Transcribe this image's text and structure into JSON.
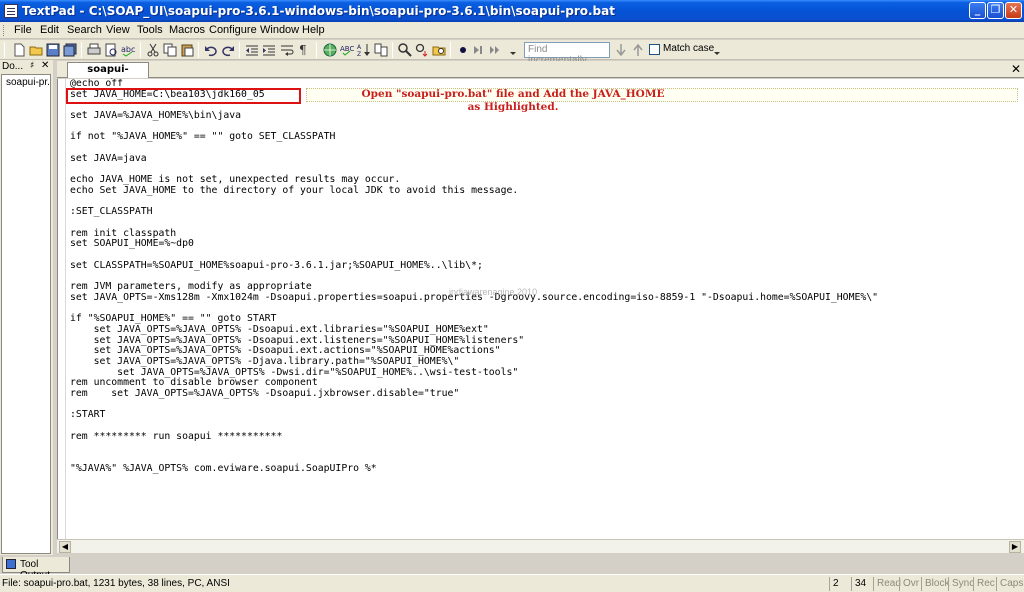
{
  "window": {
    "title": "TextPad - C:\\SOAP_UI\\soapui-pro-3.6.1-windows-bin\\soapui-pro-3.6.1\\bin\\soapui-pro.bat",
    "minimize": "_",
    "maximize": "❐",
    "close": "✕"
  },
  "menu": [
    "File",
    "Edit",
    "Search",
    "View",
    "Tools",
    "Macros",
    "Configure",
    "Window",
    "Help"
  ],
  "toolbar": {
    "find_placeholder": "Find incrementally",
    "match_case": "Match case"
  },
  "doc_pane": {
    "label": "Do...",
    "pin": "♯",
    "close": "✕",
    "items": [
      "soapui-pr..."
    ]
  },
  "editor": {
    "tab_label": "soapui-pro.bat",
    "tab_close": "✕",
    "lines": [
      "@echo off",
      "set JAVA_HOME=C:\\bea103\\jdk160_05",
      "",
      "set JAVA=%JAVA_HOME%\\bin\\java",
      "",
      "if not \"%JAVA_HOME%\" == \"\" goto SET_CLASSPATH",
      "",
      "set JAVA=java",
      "",
      "echo JAVA_HOME is not set, unexpected results may occur.",
      "echo Set JAVA_HOME to the directory of your local JDK to avoid this message.",
      "",
      ":SET_CLASSPATH",
      "",
      "rem init classpath",
      "set SOAPUI_HOME=%~dp0",
      "",
      "set CLASSPATH=%SOAPUI_HOME%soapui-pro-3.6.1.jar;%SOAPUI_HOME%..\\lib\\*;",
      "",
      "rem JVM parameters, modify as appropriate",
      "set JAVA_OPTS=-Xms128m -Xmx1024m -Dsoapui.properties=soapui.properties -Dgroovy.source.encoding=iso-8859-1 \"-Dsoapui.home=%SOAPUI_HOME%\\\"",
      "",
      "if \"%SOAPUI_HOME%\" == \"\" goto START",
      "    set JAVA_OPTS=%JAVA_OPTS% -Dsoapui.ext.libraries=\"%SOAPUI_HOME%ext\"",
      "    set JAVA_OPTS=%JAVA_OPTS% -Dsoapui.ext.listeners=\"%SOAPUI_HOME%listeners\"",
      "    set JAVA_OPTS=%JAVA_OPTS% -Dsoapui.ext.actions=\"%SOAPUI_HOME%actions\"",
      "    set JAVA_OPTS=%JAVA_OPTS% -Djava.library.path=\"%SOAPUI_HOME%\\\"",
      "        set JAVA_OPTS=%JAVA_OPTS% -Dwsi.dir=\"%SOAPUI_HOME%..\\wsi-test-tools\"",
      "rem uncomment to disable browser component",
      "rem    set JAVA_OPTS=%JAVA_OPTS% -Dsoapui.jxbrowser.disable=\"true\"",
      "",
      ":START",
      "",
      "rem ********* run soapui ***********",
      "",
      "",
      "\"%JAVA%\" %JAVA_OPTS% com.eviware.soapui.SoapUIPro %*"
    ],
    "annotation": "Open \"soapui-pro.bat\" file and Add the JAVA_HOME\nas Highlighted.",
    "watermark": "indiawarenagine 2010"
  },
  "tool_output": {
    "label": "Tool Output"
  },
  "status": {
    "text": "File: soapui-pro.bat, 1231 bytes, 38 lines, PC, ANSI",
    "line": "2",
    "col": "34",
    "read": "Read",
    "ovr": "Ovr",
    "block": "Block",
    "sync": "Sync",
    "rec": "Rec",
    "caps": "Caps"
  },
  "colors": {
    "titlebar": "#0553d6",
    "highlight_border": "#d11111",
    "annotation_text": "#c8201c"
  }
}
